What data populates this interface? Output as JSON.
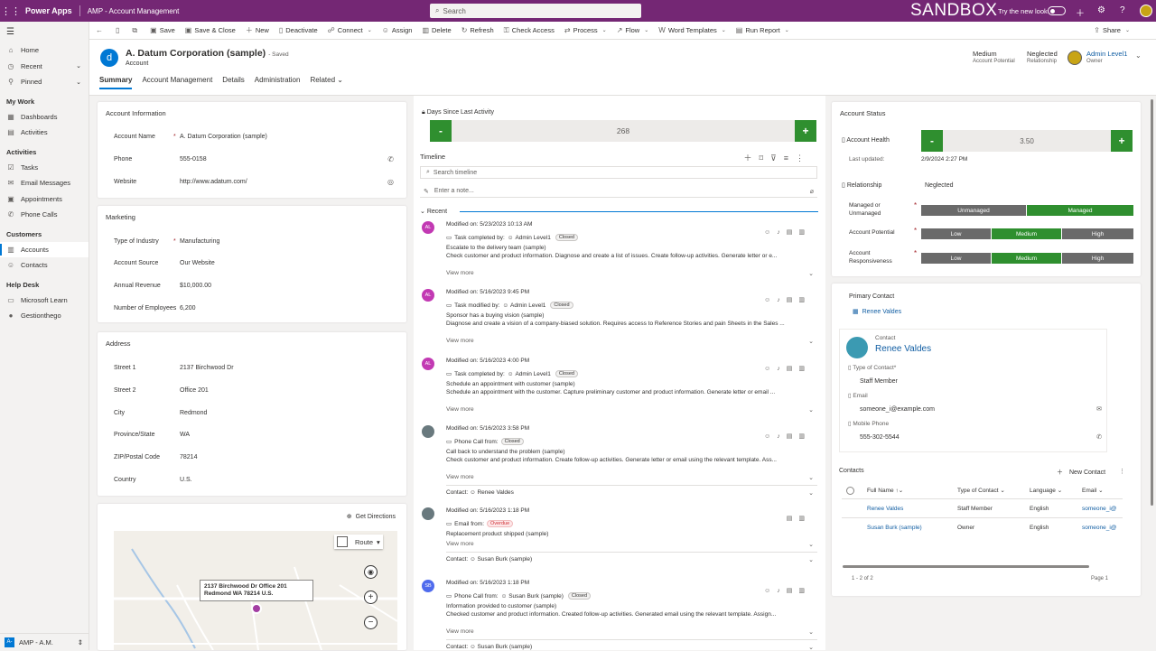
{
  "topbar": {
    "app": "Power Apps",
    "env": "AMP - Account Management",
    "search_placeholder": "Search",
    "sandbox": "SANDBOX",
    "try_new": "Try the new look"
  },
  "sidebar": {
    "items_top": [
      {
        "label": "Home",
        "icon": "home-icon"
      },
      {
        "label": "Recent",
        "icon": "clock-icon"
      },
      {
        "label": "Pinned",
        "icon": "pin-icon"
      }
    ],
    "groups": [
      {
        "title": "My Work",
        "items": [
          "Dashboards",
          "Activities"
        ]
      },
      {
        "title": "Activities",
        "items": [
          "Tasks",
          "Email Messages",
          "Appointments",
          "Phone Calls"
        ]
      },
      {
        "title": "Customers",
        "items": [
          "Accounts",
          "Contacts"
        ]
      },
      {
        "title": "Help Desk",
        "items": [
          "Microsoft Learn",
          "Gestionthego"
        ]
      }
    ],
    "area_badge": "A-",
    "area": "AMP - A.M."
  },
  "commands": [
    "Save",
    "Save & Close",
    "New",
    "Deactivate",
    "Connect",
    "Assign",
    "Delete",
    "Refresh",
    "Check Access",
    "Process",
    "Flow",
    "Word Templates",
    "Run Report"
  ],
  "share": "Share",
  "record": {
    "title": "A. Datum Corporation (sample)",
    "saved": "- Saved",
    "type": "Account",
    "potential": "Medium",
    "potential_label": "Account Potential",
    "relationship": "Neglected",
    "relationship_label": "Relationship",
    "owner": "Admin Level1",
    "owner_label": "Owner"
  },
  "tabs": [
    "Summary",
    "Account Management",
    "Details",
    "Administration",
    "Related"
  ],
  "account_info": {
    "title": "Account Information",
    "fields": [
      {
        "label": "Account Name",
        "value": "A. Datum Corporation (sample)",
        "req": "*"
      },
      {
        "label": "Phone",
        "value": "555-0158",
        "req": ""
      },
      {
        "label": "Website",
        "value": "http://www.adatum.com/",
        "req": ""
      }
    ]
  },
  "marketing": {
    "title": "Marketing",
    "fields": [
      {
        "label": "Type of Industry",
        "value": "Manufacturing",
        "req": "*"
      },
      {
        "label": "Account Source",
        "value": "Our Website",
        "req": ""
      },
      {
        "label": "Annual Revenue",
        "value": "$10,000.00",
        "req": ""
      },
      {
        "label": "Number of Employees",
        "value": "6,200",
        "req": ""
      }
    ]
  },
  "address": {
    "title": "Address",
    "fields": [
      {
        "label": "Street 1",
        "value": "2137 Birchwood Dr"
      },
      {
        "label": "Street 2",
        "value": "Office 201"
      },
      {
        "label": "City",
        "value": "Redmond"
      },
      {
        "label": "Province/State",
        "value": "WA"
      },
      {
        "label": "ZIP/Postal Code",
        "value": "78214"
      },
      {
        "label": "Country",
        "value": "U.S."
      }
    ]
  },
  "map": {
    "directions": "Get Directions",
    "route": "Route",
    "pin_line1": "2137 Birchwood Dr Office 201",
    "pin_line2": "Redmond WA 78214 U.S."
  },
  "days_since": {
    "label": "Days Since Last Activity",
    "value": "268",
    "minus": "-",
    "plus": "+"
  },
  "timeline": {
    "title": "Timeline",
    "search": "Search timeline",
    "note": "Enter a note...",
    "recent": "Recent",
    "view_more": "View more",
    "entries": [
      {
        "av": "AL",
        "color": "#c239b3",
        "modified": "Modified on: 5/23/2023 10:13 AM",
        "kind": "Task completed by:",
        "who": "Admin Level1",
        "status": "Closed",
        "subject": "Escalate to the delivery team (sample)",
        "desc": "Check customer and product information. Diagnose and create a list of issues. Create follow-up activities. Generate letter or e...",
        "contact": ""
      },
      {
        "av": "AL",
        "color": "#c239b3",
        "modified": "Modified on: 5/16/2023 9:45 PM",
        "kind": "Task modified by:",
        "who": "Admin Level1",
        "status": "Closed",
        "subject": "Sponsor has a buying vision (sample)",
        "desc": "Diagnose and create a vision of a company-biased solution. Requires access to Reference Stories and pain Sheets in the Sales ...",
        "contact": ""
      },
      {
        "av": "AL",
        "color": "#c239b3",
        "modified": "Modified on: 5/16/2023 4:00 PM",
        "kind": "Task completed by:",
        "who": "Admin Level1",
        "status": "Closed",
        "subject": "Schedule an appointment with customer (sample)",
        "desc": "Schedule an appointment with the customer. Capture preliminary customer and product information. Generate letter or email ...",
        "contact": ""
      },
      {
        "av": "",
        "color": "#69797e",
        "modified": "Modified on: 5/16/2023 3:58 PM",
        "kind": "Phone Call from:",
        "who": "",
        "status": "Closed",
        "subject": "Call back to understand the problem (sample)",
        "desc": "Check customer and product information. Create follow-up activities. Generate letter or email using the relevant template. Ass...",
        "contact": "Renee Valdes"
      },
      {
        "av": "",
        "color": "#69797e",
        "modified": "Modified on: 5/16/2023 1:18 PM",
        "kind": "Email from:",
        "who": "",
        "status": "Overdue",
        "subject": "Replacement product shipped (sample)",
        "desc": "",
        "contact": "Susan Burk (sample)"
      },
      {
        "av": "SB",
        "color": "#4f6bed",
        "modified": "Modified on: 5/16/2023 1:18 PM",
        "kind": "Phone Call from:",
        "who": "Susan Burk (sample)",
        "status": "Closed",
        "subject": "Information provided to customer (sample)",
        "desc": "Checked customer and product information. Created follow-up activities. Generated email using the relevant template. Assign...",
        "contact": "Susan Burk (sample)"
      }
    ]
  },
  "contact_label": "Contact:",
  "status": {
    "title": "Account Status",
    "health_label": "Account Health",
    "health": "3.50",
    "minus": "-",
    "plus": "+",
    "updated_label": "Last updated:",
    "updated": "2/9/2024 2:27 PM",
    "relationship_label": "Relationship",
    "relationship": "Neglected",
    "managed_label": "Managed or Unmanaged",
    "managed_opts": [
      "Unmanaged",
      "Managed"
    ],
    "potential_label": "Account Potential",
    "potential_opts": [
      "Low",
      "Medium",
      "High"
    ],
    "resp_label": "Account Responsiveness",
    "resp_opts": [
      "Low",
      "Medium",
      "High"
    ]
  },
  "primary": {
    "label": "Primary Contact",
    "name": "Renee Valdes",
    "card_type": "Contact",
    "card_name": "Renee Valdes",
    "toc_label": "Type of Contact*",
    "toc": "Staff Member",
    "email_label": "Email",
    "email": "someone_i@example.com",
    "mobile_label": "Mobile Phone",
    "mobile": "555-302-5544"
  },
  "contacts": {
    "title": "Contacts",
    "new": "New Contact",
    "cols": [
      "Full Name",
      "Type of Contact",
      "Language",
      "Email"
    ],
    "rows": [
      {
        "name": "Renee Valdes",
        "type": "Staff Member",
        "lang": "English",
        "email": "someone_i@"
      },
      {
        "name": "Susan Burk (sample)",
        "type": "Owner",
        "lang": "English",
        "email": "someone_i@"
      }
    ],
    "count": "1 - 2 of 2",
    "page": "Page 1"
  }
}
